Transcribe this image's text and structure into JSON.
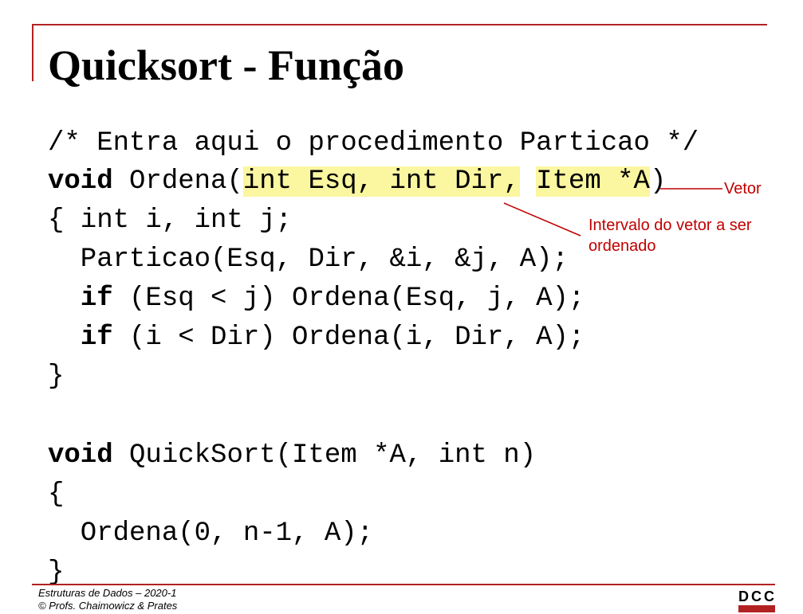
{
  "title": "Quicksort - Função",
  "code": {
    "line1": "/* Entra aqui o procedimento Particao */",
    "line2": {
      "kw": "void",
      "pre": " Ordena(",
      "hl1": "int Esq, int Dir,",
      "sp": " ",
      "hl2": "Item *A",
      "post": ")"
    },
    "line3": "{ int i, int j;",
    "line4": "  Particao(Esq, Dir, &i, &j, A);",
    "line5": {
      "indent": "  ",
      "kw": "if",
      "rest": " (Esq < j) Ordena(Esq, j, A);"
    },
    "line6": {
      "indent": "  ",
      "kw": "if",
      "rest": " (i < Dir) Ordena(i, Dir, A);"
    },
    "line7": "}",
    "line8": {
      "kw": "void",
      "rest": " QuickSort(Item *A, int n)"
    },
    "line9": "{",
    "line10": "  Ordena(0, n-1, A);",
    "line11": "}"
  },
  "annotations": {
    "vetor": "Vetor",
    "intervalo_line1": "Intervalo do vetor a ser",
    "intervalo_line2": "ordenado"
  },
  "footer": {
    "course": "Estruturas de Dados – 2020-1",
    "credits": "© Profs. Chaimowicz & Prates",
    "logo": "DCC"
  },
  "colors": {
    "accent": "#b22222",
    "annotation": "#c00000",
    "highlight": "#fbf6a0"
  }
}
